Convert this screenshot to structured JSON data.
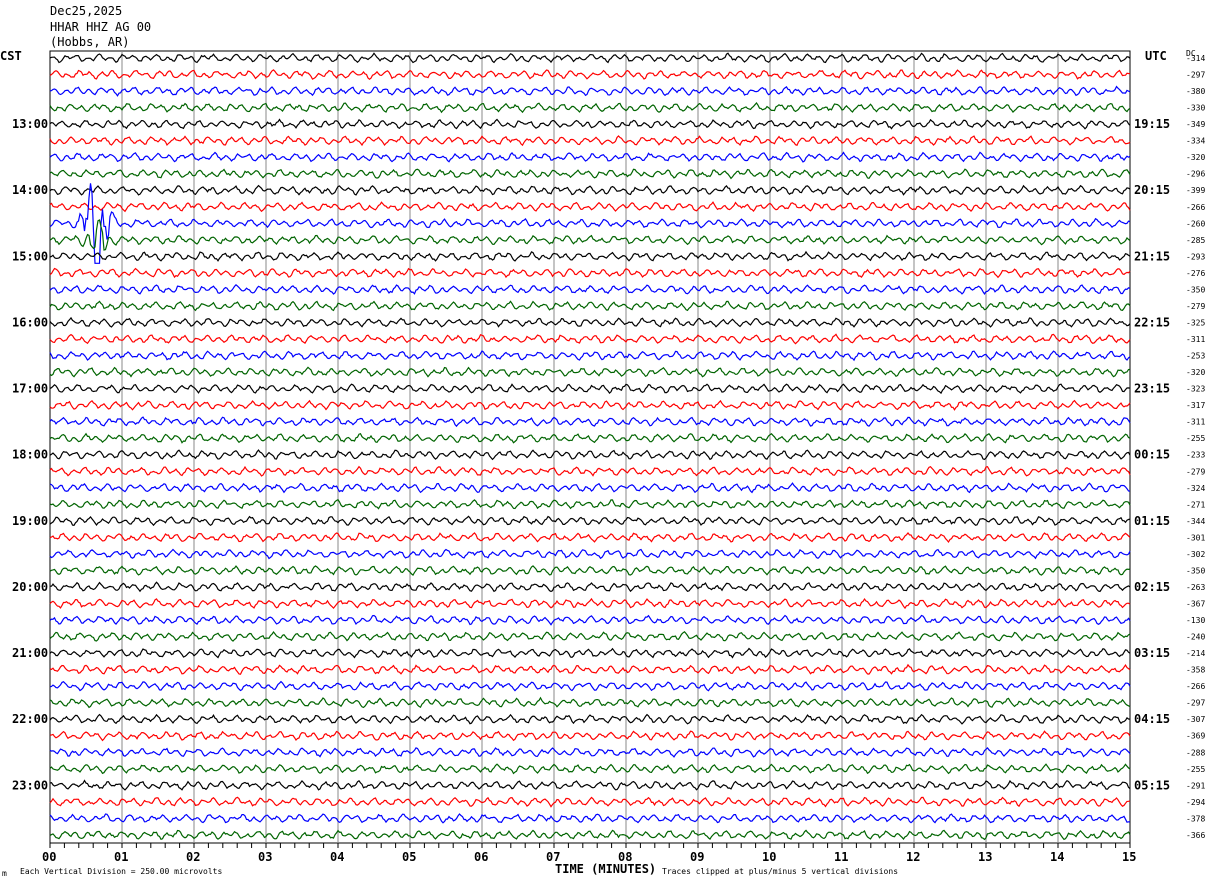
{
  "header": {
    "date": "Dec25,2025",
    "station": "HHAR HHZ AG 00",
    "location": "(Hobbs, AR)"
  },
  "left_tz": "CST",
  "right_tz": "UTC",
  "dc_label": "DC",
  "footer": {
    "scale": "Each Vertical Division =  250.00 microvolts",
    "xlabel": "TIME (MINUTES)",
    "clip_note": "Traces clipped at plus/minus 5 vertical divisions"
  },
  "chart_data": {
    "type": "line",
    "subtype": "helicorder",
    "xlabel": "TIME (MINUTES)",
    "xlim": [
      0,
      15
    ],
    "x_ticks": [
      "00",
      "01",
      "02",
      "03",
      "04",
      "05",
      "06",
      "07",
      "08",
      "09",
      "10",
      "11",
      "12",
      "13",
      "14",
      "15"
    ],
    "grid": "vertical every minute",
    "trace_colors": [
      "#000000",
      "#ff0000",
      "#0000ff",
      "#006400"
    ],
    "left_hour_labels": [
      "13:00",
      "14:00",
      "15:00",
      "16:00",
      "17:00",
      "18:00",
      "19:00",
      "20:00",
      "21:00",
      "22:00",
      "23:00"
    ],
    "right_hour_labels": [
      "19:15",
      "20:15",
      "21:15",
      "22:15",
      "23:15",
      "00:15",
      "01:15",
      "02:15",
      "03:15",
      "04:15",
      "05:15"
    ],
    "dc_offsets": [
      -314,
      -297,
      -380,
      -330,
      -349,
      -334,
      -320,
      -296,
      -399,
      -266,
      -260,
      -285,
      -293,
      -276,
      -350,
      -279,
      -325,
      -311,
      -253,
      -320,
      -323,
      -317,
      -311,
      -255,
      -233,
      -279,
      -324,
      -271,
      -344,
      -301,
      -302,
      -350,
      -263,
      -367,
      -130,
      -240,
      -214,
      -358,
      -266,
      -297,
      -307,
      -369,
      -288,
      -255,
      -291,
      -294,
      -378,
      -366
    ]
  }
}
